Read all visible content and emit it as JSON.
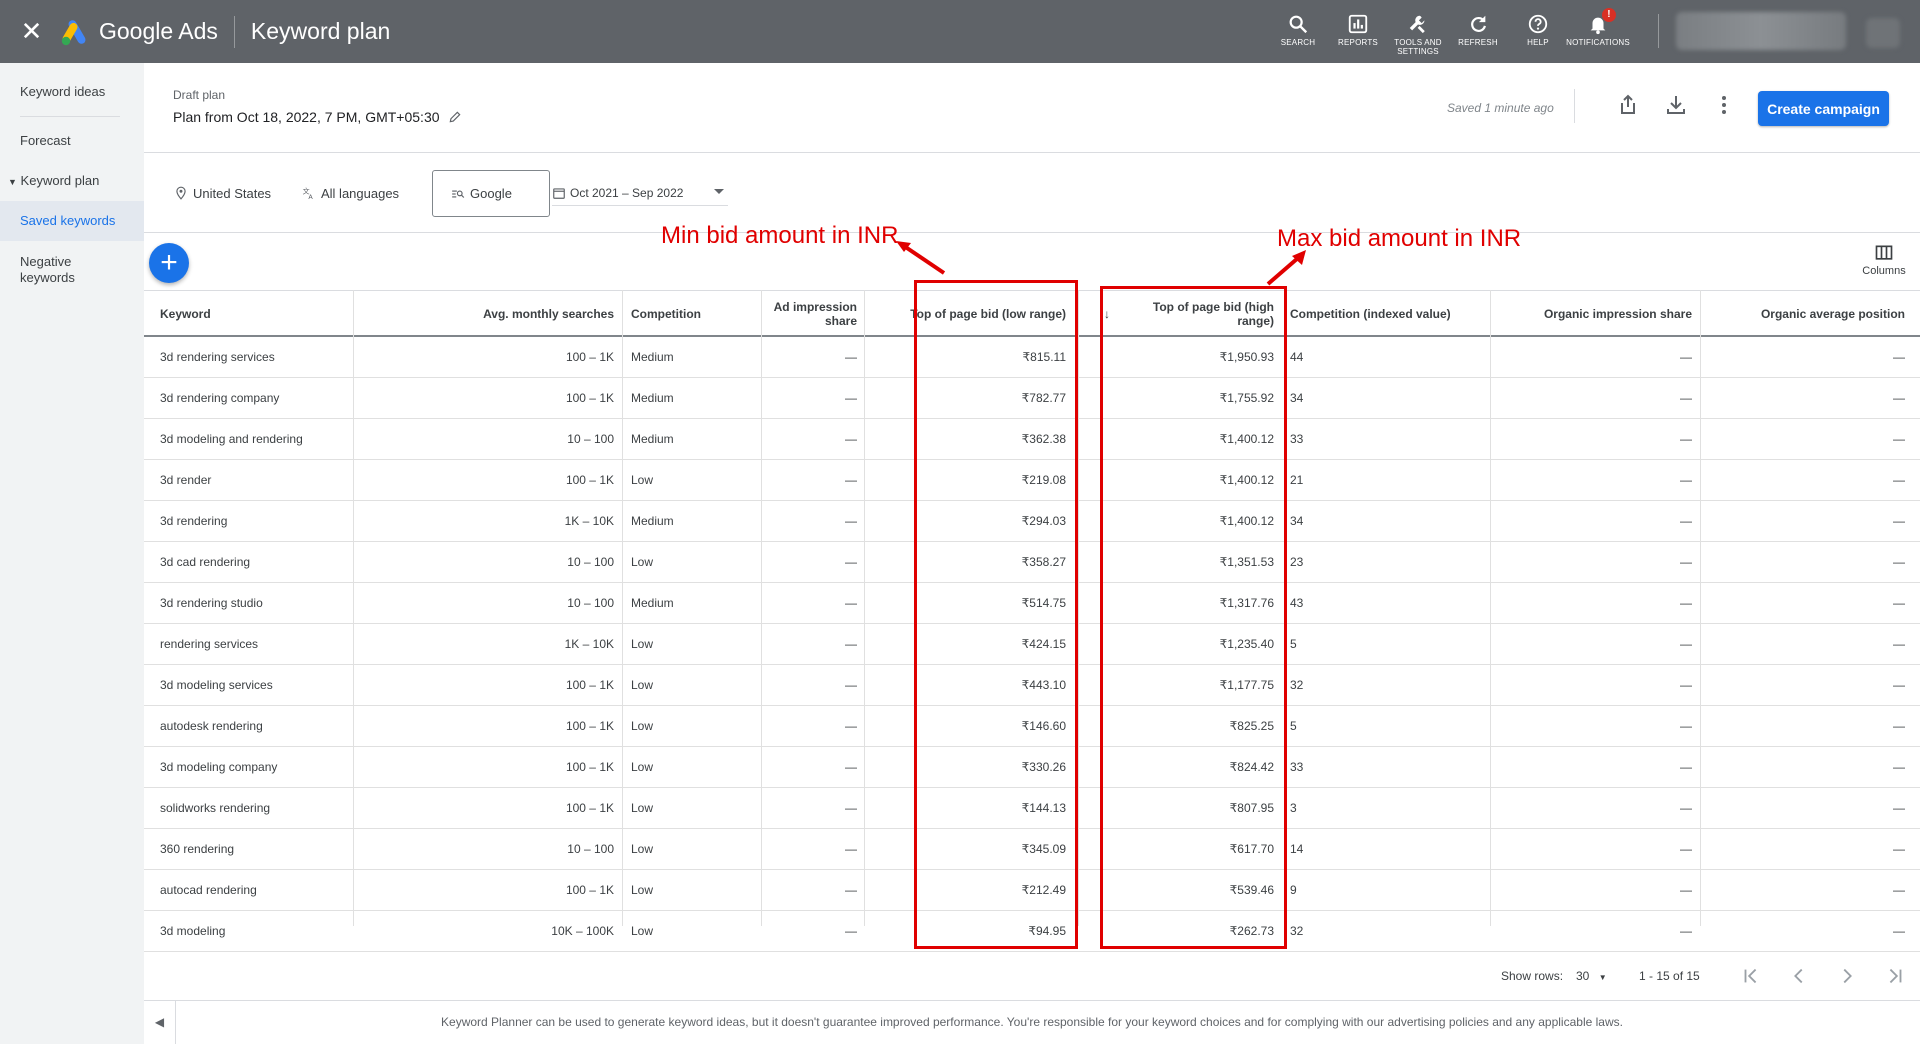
{
  "topbar": {
    "brand": "Google Ads",
    "page_title": "Keyword plan",
    "tools": [
      {
        "label": "SEARCH",
        "icon": "search-icon"
      },
      {
        "label": "REPORTS",
        "icon": "reports-icon"
      },
      {
        "label": "TOOLS AND SETTINGS",
        "icon": "wrench-icon"
      },
      {
        "label": "REFRESH",
        "icon": "refresh-icon"
      },
      {
        "label": "HELP",
        "icon": "help-icon"
      },
      {
        "label": "NOTIFICATIONS",
        "icon": "bell-icon",
        "badge": "!"
      }
    ]
  },
  "sidebar": {
    "items": [
      {
        "label": "Keyword ideas"
      },
      {
        "label": "Forecast"
      },
      {
        "label": "Keyword plan"
      },
      {
        "label": "Saved keywords"
      },
      {
        "label": "Negative keywords"
      }
    ]
  },
  "plan": {
    "draft_label": "Draft plan",
    "name": "Plan from Oct 18, 2022, 7 PM, GMT+05:30",
    "saved_status": "Saved 1 minute ago",
    "create_button": "Create campaign"
  },
  "filters": {
    "location": "United States",
    "language": "All languages",
    "network": "Google",
    "date_range": "Oct 2021 – Sep 2022"
  },
  "toolbar": {
    "columns_label": "Columns"
  },
  "table": {
    "headers": [
      "Keyword",
      "Avg. monthly searches",
      "Competition",
      "Ad impression share",
      "Top of page bid (low range)",
      "Top of page bid (high range)",
      "Competition (indexed value)",
      "Organic impression share",
      "Organic average position"
    ],
    "rows": [
      [
        "3d rendering services",
        "100 – 1K",
        "Medium",
        "—",
        "₹815.11",
        "₹1,950.93",
        "44",
        "—",
        "—"
      ],
      [
        "3d rendering company",
        "100 – 1K",
        "Medium",
        "—",
        "₹782.77",
        "₹1,755.92",
        "34",
        "—",
        "—"
      ],
      [
        "3d modeling and rendering",
        "10 – 100",
        "Medium",
        "—",
        "₹362.38",
        "₹1,400.12",
        "33",
        "—",
        "—"
      ],
      [
        "3d render",
        "100 – 1K",
        "Low",
        "—",
        "₹219.08",
        "₹1,400.12",
        "21",
        "—",
        "—"
      ],
      [
        "3d rendering",
        "1K – 10K",
        "Medium",
        "—",
        "₹294.03",
        "₹1,400.12",
        "34",
        "—",
        "—"
      ],
      [
        "3d cad rendering",
        "10 – 100",
        "Low",
        "—",
        "₹358.27",
        "₹1,351.53",
        "23",
        "—",
        "—"
      ],
      [
        "3d rendering studio",
        "10 – 100",
        "Medium",
        "—",
        "₹514.75",
        "₹1,317.76",
        "43",
        "—",
        "—"
      ],
      [
        "rendering services",
        "1K – 10K",
        "Low",
        "—",
        "₹424.15",
        "₹1,235.40",
        "5",
        "—",
        "—"
      ],
      [
        "3d modeling services",
        "100 – 1K",
        "Low",
        "—",
        "₹443.10",
        "₹1,177.75",
        "32",
        "—",
        "—"
      ],
      [
        "autodesk rendering",
        "100 – 1K",
        "Low",
        "—",
        "₹146.60",
        "₹825.25",
        "5",
        "—",
        "—"
      ],
      [
        "3d modeling company",
        "100 – 1K",
        "Low",
        "—",
        "₹330.26",
        "₹824.42",
        "33",
        "—",
        "—"
      ],
      [
        "solidworks rendering",
        "100 – 1K",
        "Low",
        "—",
        "₹144.13",
        "₹807.95",
        "3",
        "—",
        "—"
      ],
      [
        "360 rendering",
        "10 – 100",
        "Low",
        "—",
        "₹345.09",
        "₹617.70",
        "14",
        "—",
        "—"
      ],
      [
        "autocad rendering",
        "100 – 1K",
        "Low",
        "—",
        "₹212.49",
        "₹539.46",
        "9",
        "—",
        "—"
      ],
      [
        "3d modeling",
        "10K – 100K",
        "Low",
        "—",
        "₹94.95",
        "₹262.73",
        "32",
        "—",
        "—"
      ]
    ]
  },
  "pagination": {
    "show_rows_label": "Show rows:",
    "rows_value": "30",
    "range": "1 - 15 of 15"
  },
  "disclaimer": "Keyword Planner can be used to generate keyword ideas, but it doesn't guarantee improved performance. You're responsible for your keyword choices and for complying with our advertising policies and any applicable laws.",
  "annotations": {
    "min_bid": "Min bid amount in INR",
    "max_bid": "Max bid amount in INR",
    "color": "#e00000"
  },
  "colors": {
    "topbar": "#5f6368",
    "accent": "#1a73e8"
  }
}
